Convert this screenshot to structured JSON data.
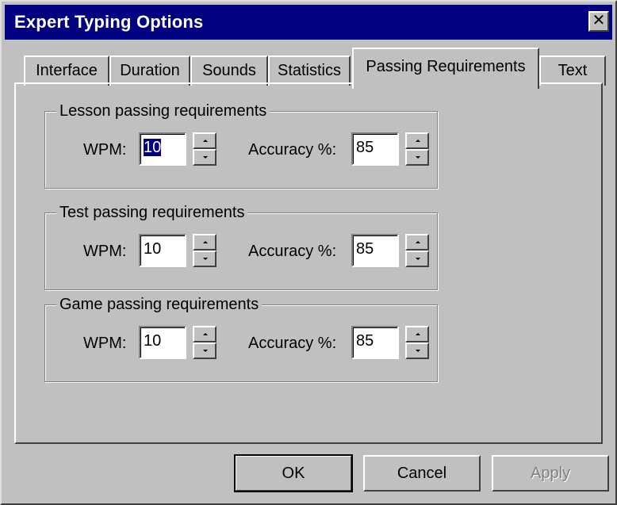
{
  "window": {
    "title": "Expert Typing Options",
    "close_glyph": "✕"
  },
  "tabs": [
    {
      "label": "Interface",
      "active": false
    },
    {
      "label": "Duration",
      "active": false
    },
    {
      "label": "Sounds",
      "active": false
    },
    {
      "label": "Statistics",
      "active": false
    },
    {
      "label": "Passing Requirements",
      "active": true
    },
    {
      "label": "Text",
      "active": false
    }
  ],
  "groups": [
    {
      "legend": "Lesson passing requirements",
      "wpm_label": "WPM:",
      "wpm_value": "10",
      "wpm_selected": true,
      "accuracy_label": "Accuracy %:",
      "accuracy_value": "85"
    },
    {
      "legend": "Test passing requirements",
      "wpm_label": "WPM:",
      "wpm_value": "10",
      "wpm_selected": false,
      "accuracy_label": "Accuracy %:",
      "accuracy_value": "85"
    },
    {
      "legend": "Game passing requirements",
      "wpm_label": "WPM:",
      "wpm_value": "10",
      "wpm_selected": false,
      "accuracy_label": "Accuracy %:",
      "accuracy_value": "85"
    }
  ],
  "buttons": {
    "ok": "OK",
    "cancel": "Cancel",
    "apply": "Apply"
  },
  "colors": {
    "face": "#c0c0c0",
    "titlebar": "#000080",
    "selection": "#000080"
  }
}
